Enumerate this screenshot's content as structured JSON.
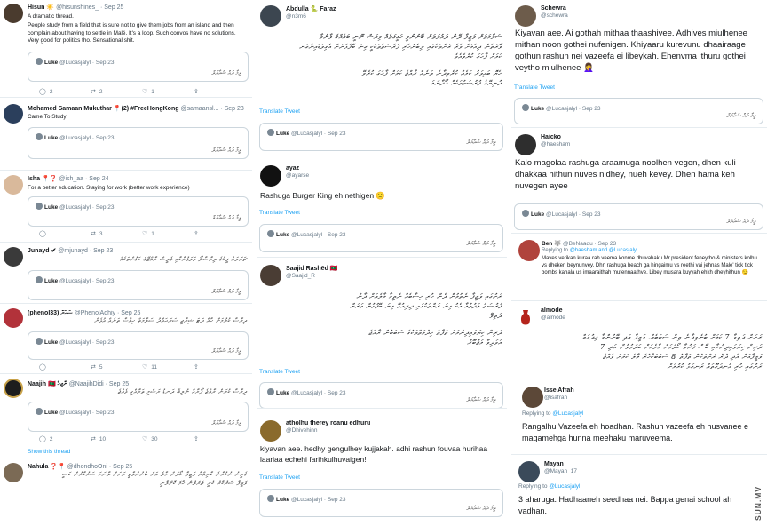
{
  "column1": [
    {
      "name": "Hisun ☀️",
      "handle": "@hisunshines_ · Sep 25",
      "lines": [
        "A dramatic thread.",
        "People study from a field that is sure not to give them jobs from an island and then complain about having to settle in Malé. It's a loop. Such convos have no solutions. Very good for politics tho. Sensational shit."
      ],
      "quote": {
        "name": "Luke",
        "handle": "@Lucasjalyl · Sep 23",
        "text": "ވީމާ ދައް ޝައާޔަލް"
      },
      "actions": [
        "2",
        "2",
        "1",
        ""
      ]
    },
    {
      "name": "Mohamed Samaan Mukuthar 📍(2) #FreeHongKong",
      "handle": "@samaansl... · Sep 23",
      "lines": [
        "Came To Study"
      ],
      "quote": {
        "name": "Luke",
        "handle": "@Lucasjalyl · Sep 23",
        "text": "ވީމާ ދައް ޝައާޔަލް"
      }
    },
    {
      "name": "Isha 📍❓",
      "handle": "@ish_aa · Sep 24",
      "lines": [
        "For a better education. Staying for work (better work experience)"
      ],
      "quote": {
        "name": "Luke",
        "handle": "@Lucasjalyl · Sep 23",
        "text": "ވީމާ ދައް ޝައާޔަލް"
      },
      "actions": [
        "",
        "3",
        "1",
        ""
      ]
    },
    {
      "name": "Junayd ✔",
      "handle": "@mjunayd · Sep 23",
      "lines": [
        "ޗަރަލައް ފީހުގެ ދިރާސާދޯ ވަލަފުރާކާއި ވެލީސް ރާއްޖޭގެ ހަގުންތަކެއް"
      ],
      "quote": {
        "name": "Luke",
        "handle": "@Lucasjalyl · Sep 23",
        "text": "ވީމާ ދައް ޝައާޔަލް"
      }
    },
    {
      "name": "(phenol33) ސަހަރާ",
      "handle": "@PhenolAdhiy · Sep 25",
      "lines": [
        "ދިރާސާ ކުރުމަށް ހާއް ދަޓަ ޝިރާޖީ ސަރަޙައްދު ސަލާމަތް ހިއްސާ ތަނެއް އުޅެން"
      ],
      "quote": {
        "name": "Luke",
        "handle": "@Lucasjalyl · Sep 23",
        "text": "ވީމާ ދައް ޝައާޔަލް"
      },
      "actions": [
        "",
        "5",
        "11",
        ""
      ]
    },
    {
      "name": "Naajih 🇲🇻 ނާޖިހް",
      "handle": "@NaajihDidi · Sep 25",
      "lines": [
        "ދިރާސާ ކުރަން ރާއްޖެ ފޯރާއް ނުލިބޭ ދަނޑު ރަސްމީ ތަރާއްގީ ވެއްޖެ"
      ],
      "quote": {
        "name": "Luke",
        "handle": "@Lucasjalyl · Sep 23",
        "text": "ވީމާ ދައް ޝައާޔަލް"
      },
      "actions": [
        "2",
        "10",
        "30",
        ""
      ],
      "show_thread": "Show this thread"
    },
    {
      "name": "Nahula ❓📍",
      "handle": "@dhondhoOni · Sep 25",
      "lines": [
        "ގެރީނު ނުކުރާނެ ކާރިއްޔާ ވަޒީފާ ހޯދަން މާލެ އަށް ބުނުންވާތީ ރަށަށް ދާނަމަ ސަރުކާރުން ކަސީ",
        "ވަޒީފާ ސަރުކާރު ކުރީ ޗަރަލުން ހާމަ ކޮށްލާނީ"
      ]
    }
  ],
  "column2": [
    {
      "name": "Abdulla 🐍 Faraz",
      "handle": "@n3m6",
      "thaana": [
        "ސަލާމަތަށް ވަޒީފާ ދޭން ދައުލަތަށް ބޭނުނުވީ ހަގީގަތެއް ވިޔަސް ނޫނީ ބައެއްގެ ވާނުވާ",
        "ވޭރަތުން ދިއުމަށް ވުރެ ރަށްތަކުގައި ލިބެންހުރި ފުރުސަތުތަކަކީ ގިނަ ބޭފުޅުނަށް އެގިވަޑައިނުގަނ",
        "ކަމަށް ފާހަގަ ކުރެވެއެވެ",
        "ހެޔޮ ބައިވަރު ކަމެއް ކުރެވިދާނެ ތަނެއް ރާއްޖެ ކަމަށް ފާހަގަ ކުރެވޭ",
        "ދުނިޔޭގެ ފުރުސަތުތަކެއް ހޯދާނަމަ"
      ],
      "translate": "Translate Tweet",
      "quote": {
        "name": "Luke",
        "handle": "@Lucasjalyl · Sep 23",
        "text": "ވީމާ ދައް ޝައާޔަލް"
      }
    },
    {
      "name": "ayaz",
      "handle": "@ayarse",
      "text": "Rashuga Burger King eh nethigen 🙁",
      "translate": "Translate Tweet",
      "quote": {
        "name": "Luke",
        "handle": "@Lucasjalyl · Sep 23",
        "text": "ވީމާ ދައް ޝައާޔަލް"
      }
    },
    {
      "name": "Saajid Rashēd 🇲🇻",
      "handle": "@Saajid_R",
      "thaana": [
        "ރަށުގައި ވަޒީފާ ނެތުމުން ދެން ހުރި ހިސާބެއް ނެތީމާ މާލެއަށް ދާން",
        "ފުރުސަތު މަދުވުމާ އެކު ގިނަ ރަށްތަކުގައި ދިރިއުޅޭ ގިނަ ބޭފުޅުން ވަރަށް",
        "ދަތިވޭ",
        "ދަރިން ކިޔަވައިދިނުމަށް ތަފާތު ހިދުމަތްތަކުގެ ސަބަބުން ރާއްޖެ",
        "އަވަދިވާ މަޖުބޫރު"
      ],
      "translate": "Translate Tweet",
      "quote": {
        "name": "Luke",
        "handle": "@Lucasjalyl · Sep 23",
        "text": "ވީމާ ދައް ޝައާޔަލް"
      }
    },
    {
      "name": "atholhu therey roanu edhuru",
      "handle": "@Dhivehinn",
      "text": "kiyavan aee. hedhy gengulhey kujjakah. adhi rashun fouvaa hurihaa laariaa echehi farihkulhuvaigen!",
      "translate": "Translate Tweet",
      "quote": {
        "name": "Luke",
        "handle": "@Lucasjalyl · Sep 23",
        "text": "ވީމާ ދައް ޝައާޔަލް"
      }
    }
  ],
  "column3": [
    {
      "name": "Schewra",
      "handle": "@schewra",
      "text": "Kiyavan aee. Ai gothah mithaa thaashivee. Adhives miulhenee mithan noon gothei nufenigen. Khiyaaru kurevunu dhaairaage gothun rashun nei vazeefa ei libeykah. Ehenvma ithuru gothei veytho miulhenee 🤦‍♀️",
      "translate": "Translate Tweet",
      "quote": {
        "name": "Luke",
        "handle": "@Lucasjalyl · Sep 23",
        "text": "ވީމާ ދައް ޝައާޔަލް"
      }
    },
    {
      "name": "Haicko",
      "handle": "@haesham",
      "text": "Kalo magolaa rashuga araamuga noolhen vegen, dhen kuli dhakkaa hithun nuves nidhey, nueh kevey. Dhen hama keh nuvegen ayee",
      "quote": {
        "name": "Luke",
        "handle": "@Lucasjalyl · Sep 23",
        "text": "ވީމާ ދައް ޝައާޔަލް"
      }
    },
    {
      "name": "Ben 🐺",
      "handle": "@BeNaadu · Sep 23",
      "reply": {
        "prefix": "Replying to ",
        "to": "@haesham and @Lucasjalyl"
      },
      "lines": [
        "Maves verikan kuraa rah veema konme dhuvahaku Mr.president feneytho & ministers kolhu vs dheken beynunvey. Dhn rashuga beach ga hingaimu vs reethi vai jehnas Male' tick tick bombs kahala us imaaraithah mufennaathve. Libey musara kuyyah ehkh dheyhithun 😏"
      ]
    },
    {
      "name": "almode",
      "handle": "@almode",
      "thaana": [
        "ރަށަށް ދަތިވާ 7 ކަމަށް ބުނެވިދާނެ ތިން ސަބަބެއް، ވަޒީފާ އަދި ބޭނުންވާ ހިދުމަތް",
        "ދަރިން ކިޔަވައިދިނުމާއި ބޭސް ފަރުވާ ހޯދުމަށް މާލެއަށް ބަދަލުވުން އަދި 7",
        "ވަޒީފާއަށް އެދި ދުރު ރަށްތަކުން ތަފާތު 8 ސަބަބަކާހުރެ މާލެ ކަމަށް ވެއްޖެ",
        "ރަށުގައި ހުރި އުނދަގޫތައް ރަނގަޅު ކުރުމަށް"
      ],
      "replies": [
        {
          "name": "Isse Afrah",
          "handle": "@isafrah",
          "reply": {
            "prefix": "Replying to ",
            "to": "@Lucasjalyl"
          },
          "text": "Rangalhu Vazeefa eh hoadhan. Rashun vazeefa eh husvanee e magamehga hunna meehaku maruveema."
        }
      ]
    },
    {
      "name": "Mayan",
      "handle": "@Mayan_17",
      "reply": {
        "prefix": "Replying to ",
        "to": "@Lucasjalyl"
      },
      "text": "3 aharuga. Hadhaaneh seedhaa nei. Bappa genai school ah vadhan."
    }
  ],
  "watermark": "SUN.MV",
  "colors": {
    "link": "#1da1f2",
    "muted": "#657786",
    "border": "#ccd6dd"
  }
}
